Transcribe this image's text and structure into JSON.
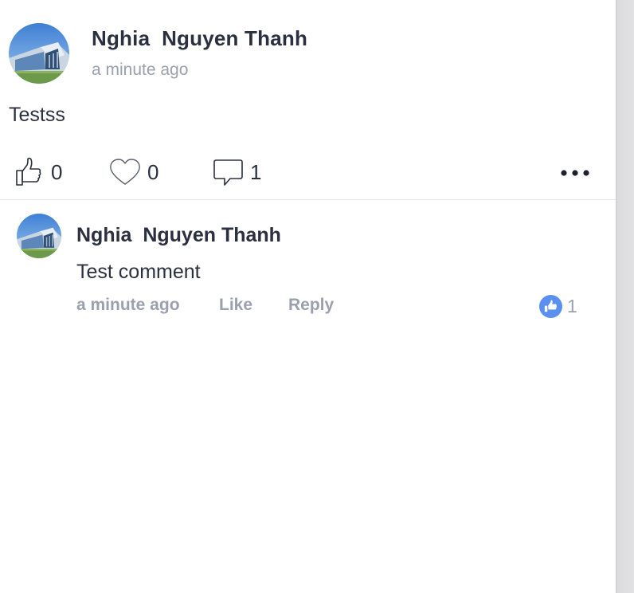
{
  "post": {
    "author": "Nghia  Nguyen Thanh",
    "timestamp": "a minute ago",
    "text": "Testss",
    "actions": {
      "like_count": "0",
      "heart_count": "0",
      "comment_count": "1"
    },
    "more_icon": "more-dots-icon"
  },
  "comment": {
    "author": "Nghia  Nguyen Thanh",
    "text": "Test comment",
    "timestamp": "a minute ago",
    "like_label": "Like",
    "reply_label": "Reply",
    "reaction_count": "1",
    "reaction_icon": "thumbs-up-icon"
  },
  "colors": {
    "text_primary": "#2b3040",
    "text_secondary": "#9aa0ad",
    "accent": "#5b8ff0"
  }
}
